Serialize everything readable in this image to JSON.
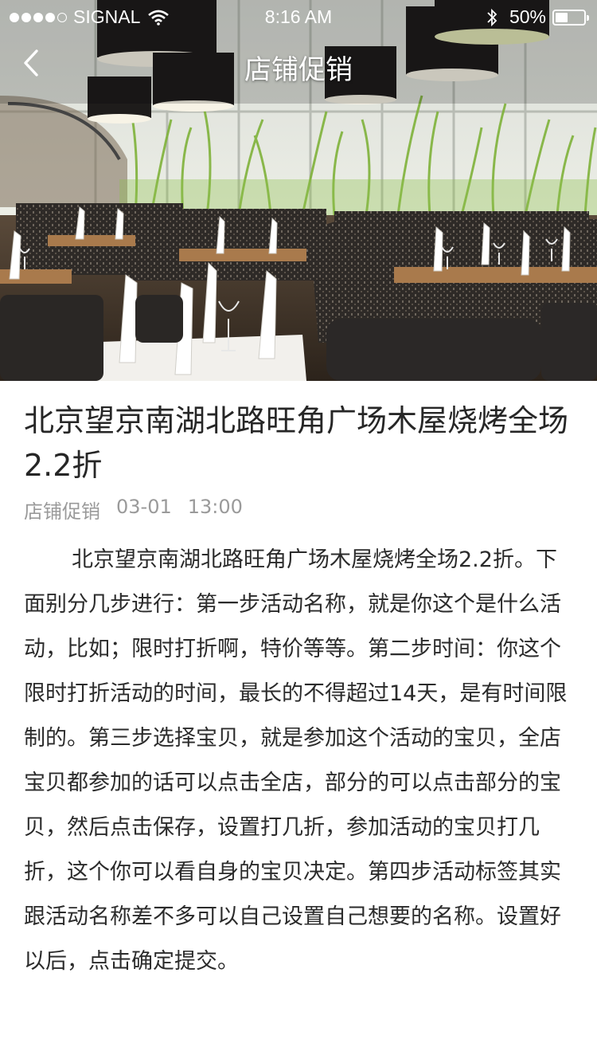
{
  "status_bar": {
    "carrier": "SIGNAL",
    "time": "8:16 AM",
    "battery": "50%",
    "battery_level": 0.5,
    "signal_bars_filled": 4,
    "signal_bars_total": 5
  },
  "nav": {
    "title": "店铺促销",
    "back_icon": "chevron-left-icon"
  },
  "article": {
    "title": "北京望京南湖北路旺角广场木屋烧烤全场2.2折",
    "category": "店铺促销",
    "date": "03-01",
    "time": "13:00",
    "body": "北京望京南湖北路旺角广场木屋烧烤全场2.2折。下面别分几步进行：第一步活动名称，就是你这个是什么活动，比如；限时打折啊，特价等等。第二步时间：你这个限时打折活动的时间，最长的不得超过14天，是有时间限制的。第三步选择宝贝，就是参加这个活动的宝贝，全店宝贝都参加的话可以点击全店，部分的可以点击部分的宝贝，然后点击保存，设置打几折，参加活动的宝贝打几折，这个你可以看自身的宝贝决定。第四步活动标签其实跟活动名称差不多可以自己设置自己想要的名称。设置好以后，点击确定提交。"
  },
  "colors": {
    "text_primary": "#262626",
    "text_meta": "#9a9a9a",
    "status_text": "#ffffff"
  }
}
